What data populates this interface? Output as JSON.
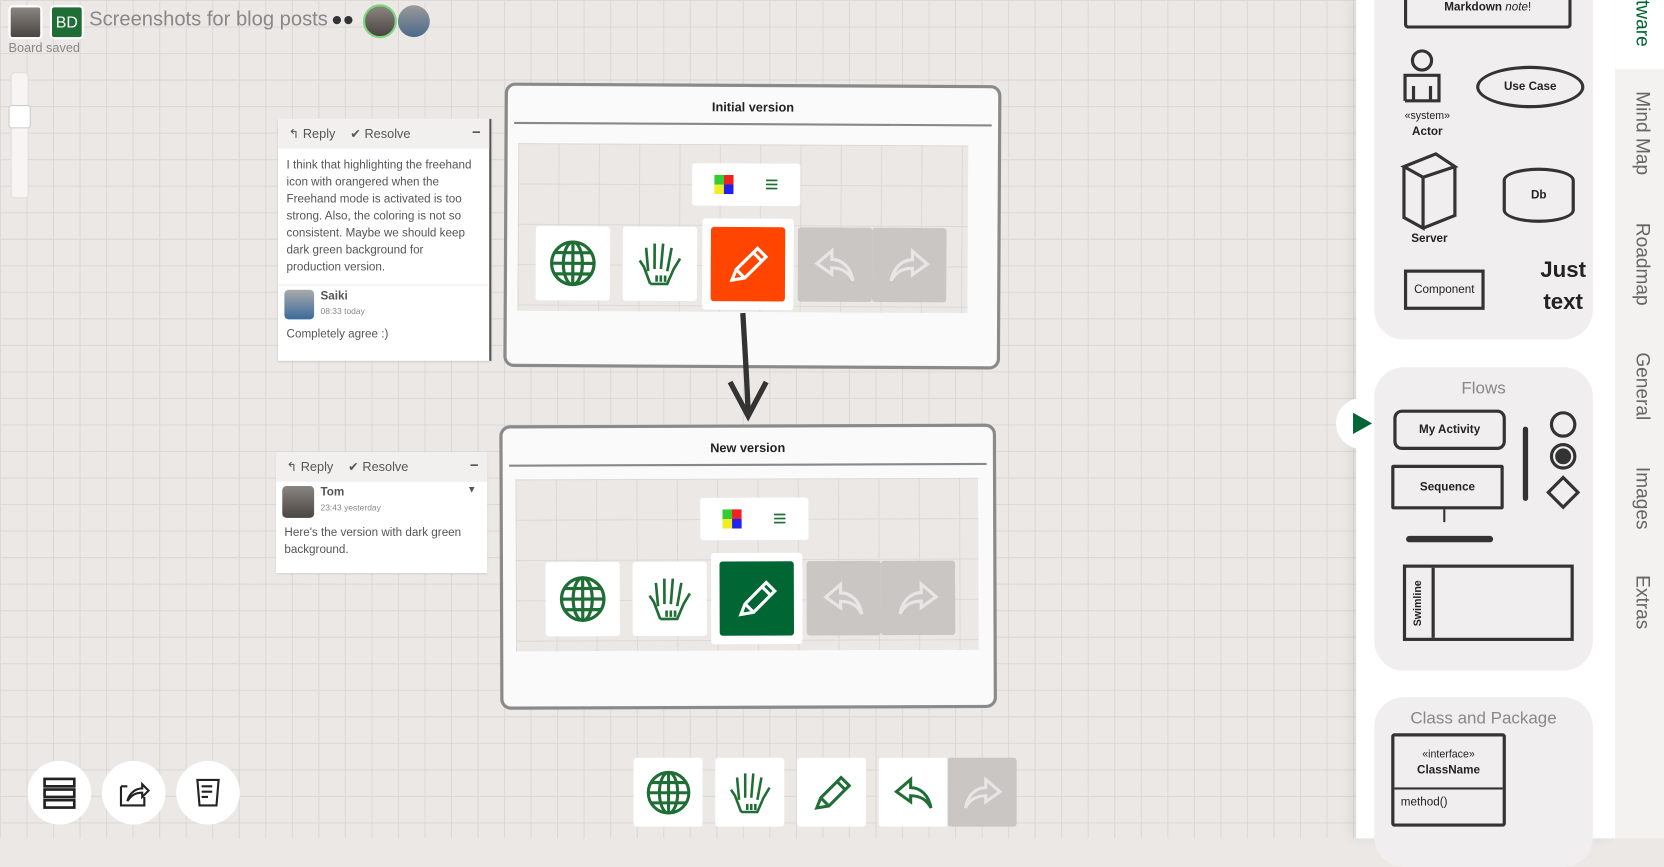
{
  "header": {
    "board_badge": "BD",
    "title": "Screenshots for blog posts",
    "status": "Board saved",
    "icons": [
      "users-icon"
    ]
  },
  "frames": [
    {
      "title": "Initial version",
      "active_tool_color": "#ff4500"
    },
    {
      "title": "New version",
      "active_tool_color": "#006633"
    }
  ],
  "comments": [
    {
      "reply": "Reply",
      "resolve": "Resolve",
      "text": "I think that highlighting the freehand icon with orangered when the Freehand mode is activated is too strong. Also, the coloring is not so consistent. Maybe we should keep dark green background for production version.",
      "reply_author": "Saiki",
      "reply_time": "08:33 today",
      "reply_text": "Completely agree :)"
    },
    {
      "reply": "Reply",
      "resolve": "Resolve",
      "author": "Tom",
      "time": "23:43 yesterday",
      "text": "Here's the version with dark green background."
    }
  ],
  "toolbar": {
    "items": [
      "globe-icon",
      "hand-icon",
      "pencil-icon",
      "undo-icon",
      "redo-icon"
    ],
    "accent": "#006633"
  },
  "bottom_left": [
    "layers-icon",
    "export-icon",
    "notes-icon"
  ],
  "palette": {
    "software": {
      "note": "Markdown",
      "note_em": "note",
      "note_tail": "!",
      "stereotype": "«system»",
      "actor": "Actor",
      "use_case": "Use Case",
      "server": "Server",
      "db": "Db",
      "component": "Component",
      "just_text": "Just text"
    },
    "flows": {
      "title": "Flows",
      "activity": "My Activity",
      "sequence": "Sequence",
      "swimline": "Swimline"
    },
    "class": {
      "title": "Class and Package",
      "stereotype": "«interface»",
      "class_name": "ClassName",
      "method": "method()"
    }
  },
  "tabs": [
    "tware",
    "Mind Map",
    "Roadmap",
    "General",
    "Images",
    "Extras"
  ]
}
